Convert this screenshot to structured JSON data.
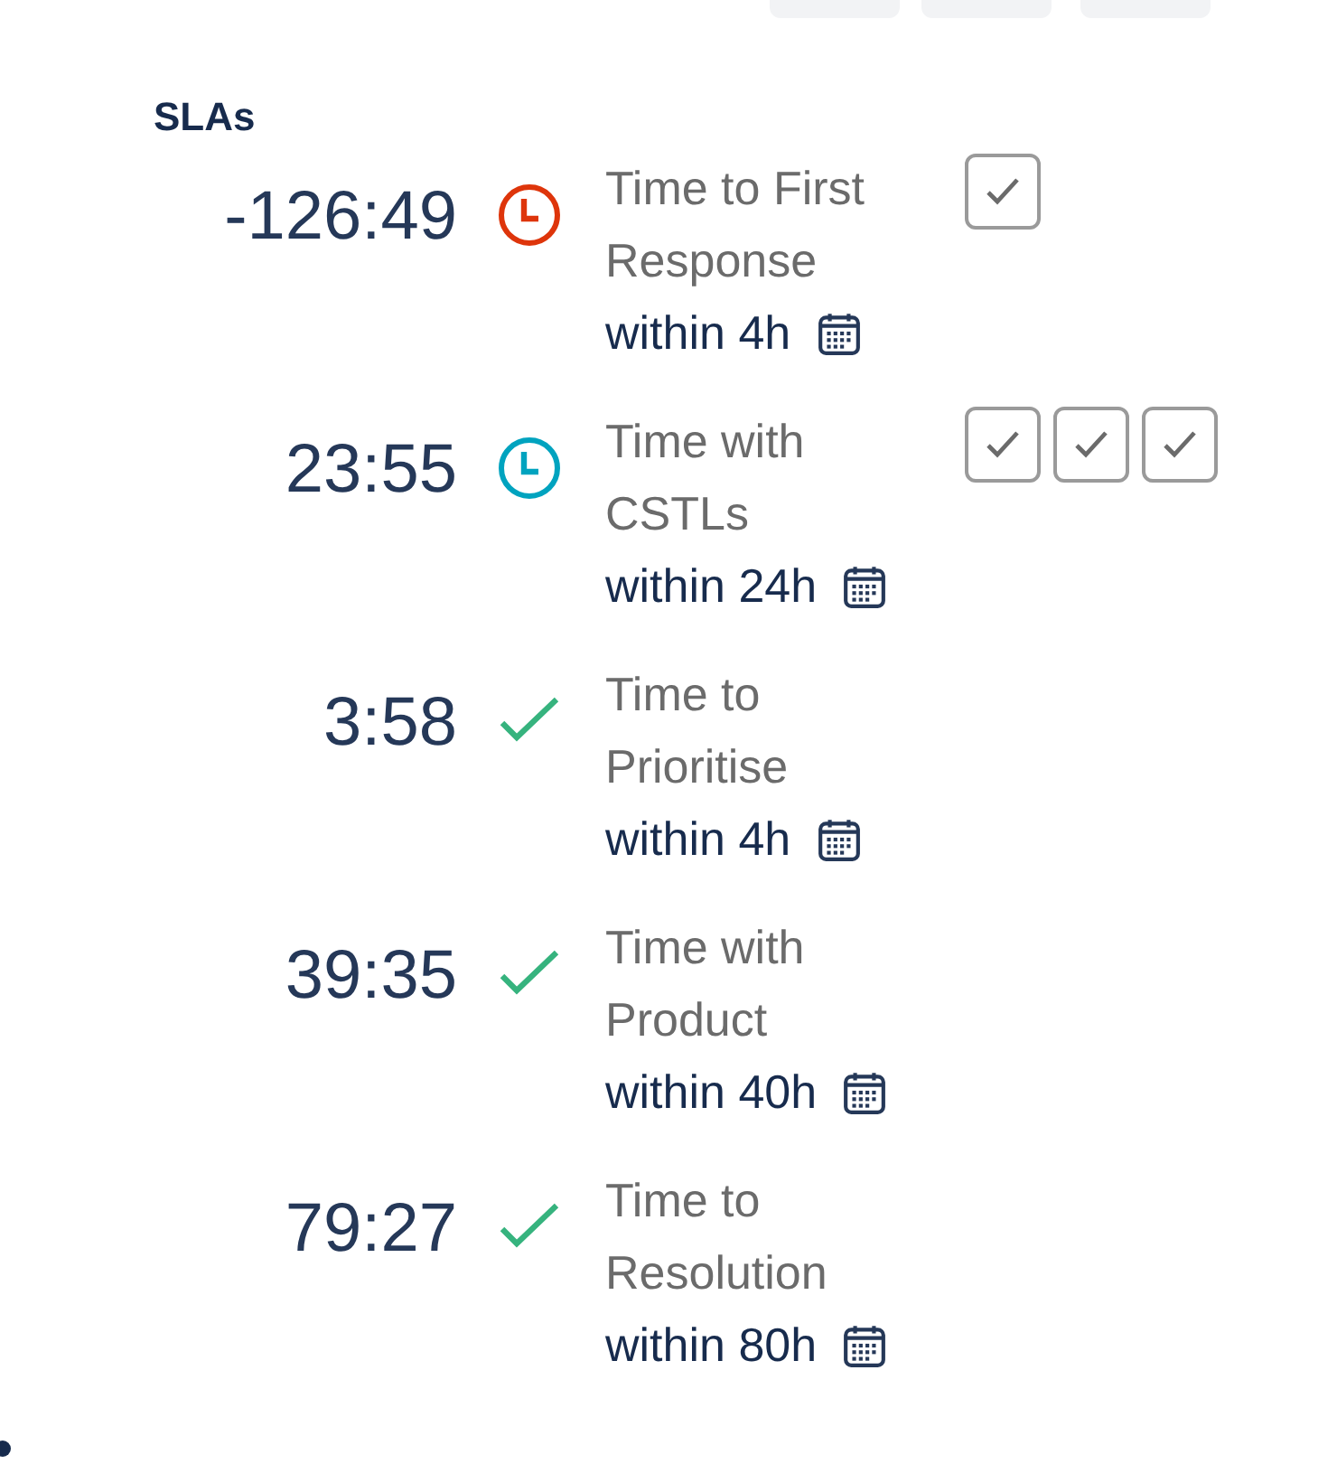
{
  "heading": "SLAs",
  "slas": [
    {
      "remaining": "-126:49",
      "kind": "breached",
      "name": "Time to First Response",
      "goal": "within 4h",
      "cycles": [
        {
          "checked": true
        }
      ]
    },
    {
      "remaining": "23:55",
      "kind": "running",
      "name": "Time with CSTLs",
      "goal": "within 24h",
      "cycles": [
        {
          "checked": true
        },
        {
          "checked": true
        },
        {
          "checked": true
        }
      ]
    },
    {
      "remaining": "3:58",
      "kind": "met",
      "name": "Time to Prioritise",
      "goal": "within 4h"
    },
    {
      "remaining": "39:35",
      "kind": "met",
      "name": "Time with Product",
      "goal": "within 40h"
    },
    {
      "remaining": "79:27",
      "kind": "met",
      "name": "Time to Resolution",
      "goal": "within 80h"
    }
  ]
}
